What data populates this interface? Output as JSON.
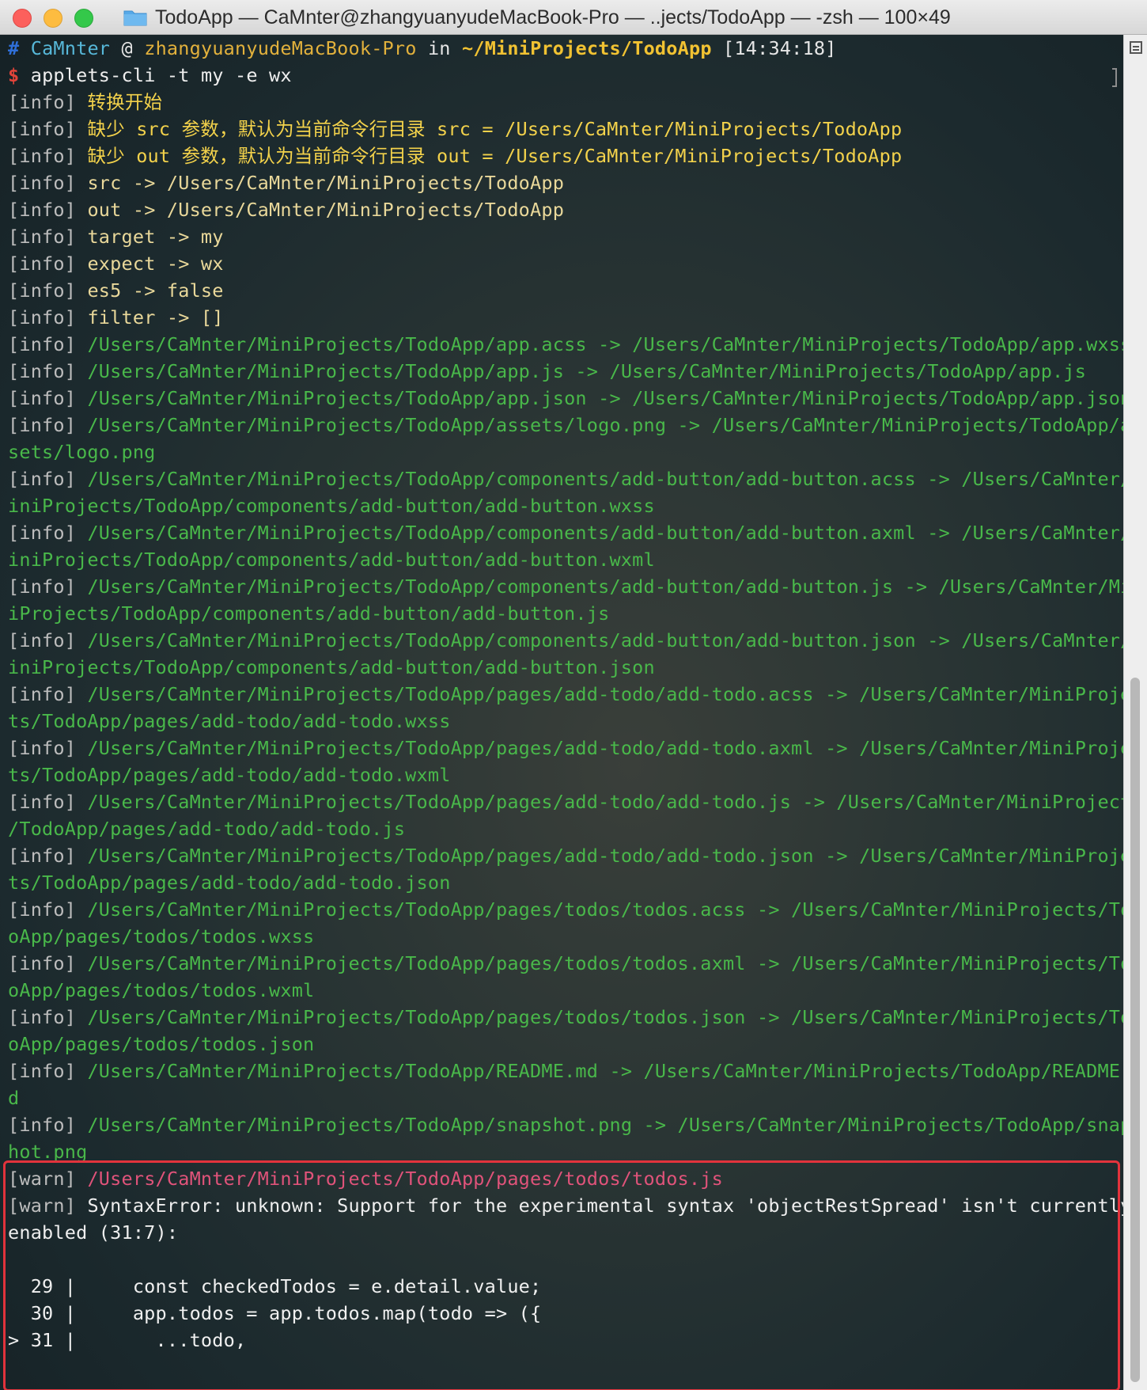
{
  "window": {
    "title": "TodoApp — CaMnter@zhangyuanyudeMacBook-Pro — ..jects/TodoApp — -zsh — 100×49",
    "icon": "folder-icon",
    "colors": {
      "close": "#fc605c",
      "minimize": "#fdbc40",
      "maximize": "#34c84a"
    }
  },
  "prompt": {
    "hash": "#",
    "user": "CaMnter",
    "at": "@",
    "host": "zhangyuanyudeMacBook-Pro",
    "in": "in",
    "path": "~/MiniProjects/TodoApp",
    "time": "[14:34:18]",
    "dollar": "$",
    "command": "applets-cli -t my -e wx"
  },
  "info_tag": "[info]",
  "warn_tag": "[warn]",
  "lines": [
    {
      "text": "转换开始",
      "color": "yellow"
    },
    {
      "text": "缺少 src 参数，默认为当前命令行目录 src = /Users/CaMnter/MiniProjects/TodoApp",
      "color": "yellow"
    },
    {
      "text": "缺少 out 参数，默认为当前命令行目录 out = /Users/CaMnter/MiniProjects/TodoApp",
      "color": "yellow"
    },
    {
      "text": "src -> /Users/CaMnter/MiniProjects/TodoApp",
      "color": "ylight"
    },
    {
      "text": "out -> /Users/CaMnter/MiniProjects/TodoApp",
      "color": "ylight"
    },
    {
      "text": "target -> my",
      "color": "ylight"
    },
    {
      "text": "expect -> wx",
      "color": "ylight"
    },
    {
      "text": "es5 -> false",
      "color": "ylight"
    },
    {
      "text": "filter -> []",
      "color": "ylight"
    },
    {
      "text": "/Users/CaMnter/MiniProjects/TodoApp/app.acss -> /Users/CaMnter/MiniProjects/TodoApp/app.wxss",
      "color": "green"
    },
    {
      "text": "/Users/CaMnter/MiniProjects/TodoApp/app.js -> /Users/CaMnter/MiniProjects/TodoApp/app.js",
      "color": "green"
    },
    {
      "text": "/Users/CaMnter/MiniProjects/TodoApp/app.json -> /Users/CaMnter/MiniProjects/TodoApp/app.json",
      "color": "green"
    },
    {
      "text": "/Users/CaMnter/MiniProjects/TodoApp/assets/logo.png -> /Users/CaMnter/MiniProjects/TodoApp/as",
      "cont": "sets/logo.png",
      "color": "green"
    },
    {
      "text": "/Users/CaMnter/MiniProjects/TodoApp/components/add-button/add-button.acss -> /Users/CaMnter/M",
      "cont": "iniProjects/TodoApp/components/add-button/add-button.wxss",
      "color": "green"
    },
    {
      "text": "/Users/CaMnter/MiniProjects/TodoApp/components/add-button/add-button.axml -> /Users/CaMnter/M",
      "cont": "iniProjects/TodoApp/components/add-button/add-button.wxml",
      "color": "green"
    },
    {
      "text": "/Users/CaMnter/MiniProjects/TodoApp/components/add-button/add-button.js -> /Users/CaMnter/Min",
      "cont": "iProjects/TodoApp/components/add-button/add-button.js",
      "color": "green"
    },
    {
      "text": "/Users/CaMnter/MiniProjects/TodoApp/components/add-button/add-button.json -> /Users/CaMnter/M",
      "cont": "iniProjects/TodoApp/components/add-button/add-button.json",
      "color": "green"
    },
    {
      "text": "/Users/CaMnter/MiniProjects/TodoApp/pages/add-todo/add-todo.acss -> /Users/CaMnter/MiniProjec",
      "cont": "ts/TodoApp/pages/add-todo/add-todo.wxss",
      "color": "green"
    },
    {
      "text": "/Users/CaMnter/MiniProjects/TodoApp/pages/add-todo/add-todo.axml -> /Users/CaMnter/MiniProjec",
      "cont": "ts/TodoApp/pages/add-todo/add-todo.wxml",
      "color": "green"
    },
    {
      "text": "/Users/CaMnter/MiniProjects/TodoApp/pages/add-todo/add-todo.js -> /Users/CaMnter/MiniProjects",
      "cont": "/TodoApp/pages/add-todo/add-todo.js",
      "color": "green"
    },
    {
      "text": "/Users/CaMnter/MiniProjects/TodoApp/pages/add-todo/add-todo.json -> /Users/CaMnter/MiniProjec",
      "cont": "ts/TodoApp/pages/add-todo/add-todo.json",
      "color": "green"
    },
    {
      "text": "/Users/CaMnter/MiniProjects/TodoApp/pages/todos/todos.acss -> /Users/CaMnter/MiniProjects/Tod",
      "cont": "oApp/pages/todos/todos.wxss",
      "color": "green"
    },
    {
      "text": "/Users/CaMnter/MiniProjects/TodoApp/pages/todos/todos.axml -> /Users/CaMnter/MiniProjects/Tod",
      "cont": "oApp/pages/todos/todos.wxml",
      "color": "green"
    },
    {
      "text": "/Users/CaMnter/MiniProjects/TodoApp/pages/todos/todos.json -> /Users/CaMnter/MiniProjects/Tod",
      "cont": "oApp/pages/todos/todos.json",
      "color": "green"
    },
    {
      "text": "/Users/CaMnter/MiniProjects/TodoApp/README.md -> /Users/CaMnter/MiniProjects/TodoApp/README.m",
      "cont": "d",
      "color": "green"
    },
    {
      "text": "/Users/CaMnter/MiniProjects/TodoApp/snapshot.png -> /Users/CaMnter/MiniProjects/TodoApp/snaps",
      "cont": "hot.png",
      "color": "green"
    }
  ],
  "warn": {
    "path": "/Users/CaMnter/MiniProjects/TodoApp/pages/todos/todos.js",
    "message": "SyntaxError: unknown: Support for the experimental syntax 'objectRestSpread' isn't currently",
    "message_cont": "enabled (31:7):",
    "code": [
      "  29 |     const checkedTodos = e.detail.value;",
      "  30 |     app.todos = app.todos.map(todo => ({",
      "> 31 |       ...todo,"
    ]
  }
}
